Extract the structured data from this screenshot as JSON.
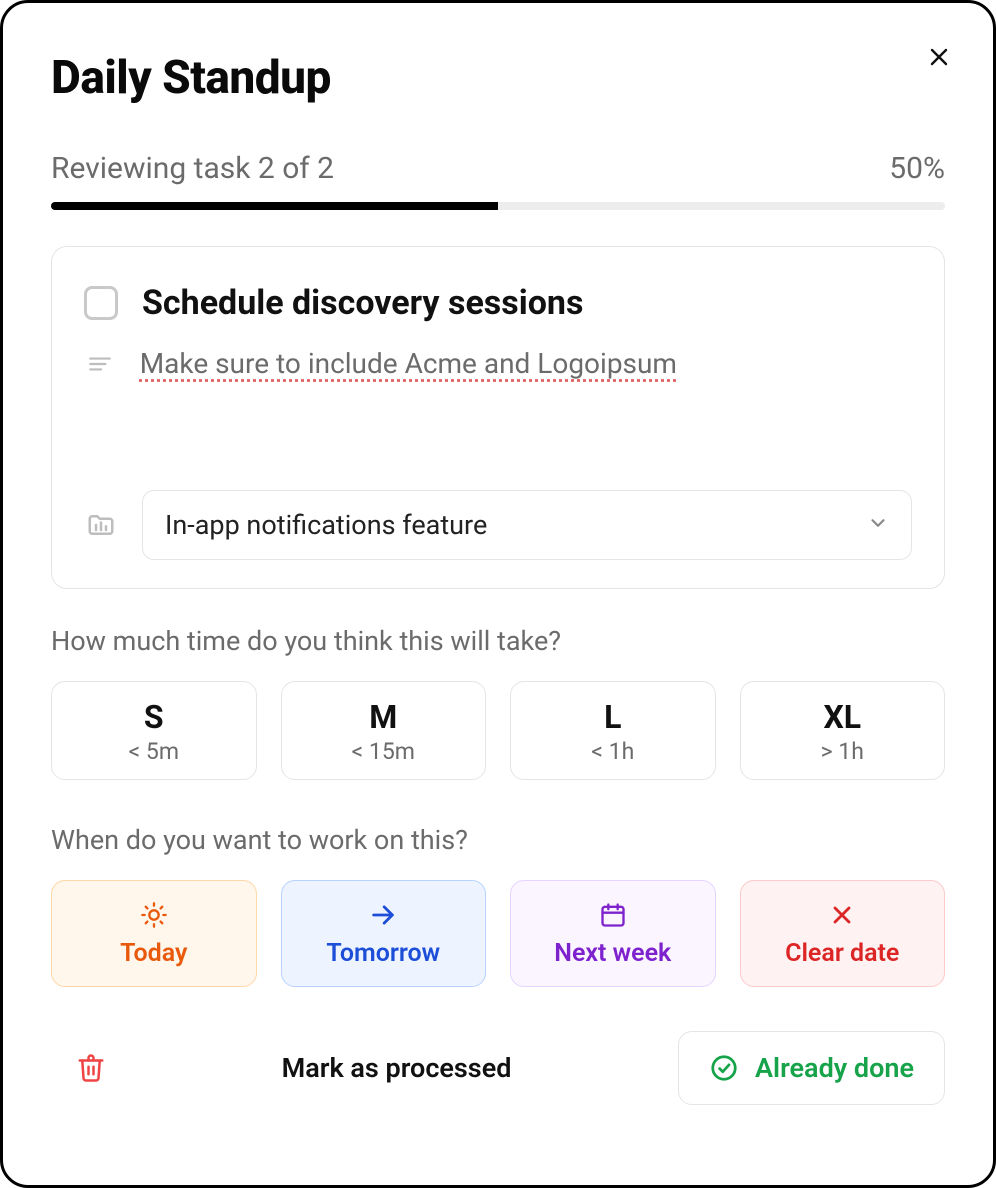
{
  "title": "Daily Standup",
  "progress": {
    "label": "Reviewing task 2 of 2",
    "percent_label": "50%",
    "percent_value": 50
  },
  "task": {
    "title": "Schedule discovery sessions",
    "description": "Make sure to include Acme and Logoipsum",
    "project": "In-app notifications feature"
  },
  "time_section": {
    "label": "How much time do you think this will take?",
    "options": [
      {
        "label": "S",
        "sub": "< 5m"
      },
      {
        "label": "M",
        "sub": "< 15m"
      },
      {
        "label": "L",
        "sub": "< 1h"
      },
      {
        "label": "XL",
        "sub": "> 1h"
      }
    ]
  },
  "schedule_section": {
    "label": "When do you want to work on this?",
    "options": {
      "today": "Today",
      "tomorrow": "Tomorrow",
      "next_week": "Next week",
      "clear": "Clear date"
    }
  },
  "footer": {
    "mark_processed": "Mark as processed",
    "already_done": "Already done"
  },
  "colors": {
    "today": "#e8590c",
    "tomorrow": "#1d4ed8",
    "next_week": "#7e22ce",
    "clear": "#dc2626",
    "success": "#16a34a"
  }
}
